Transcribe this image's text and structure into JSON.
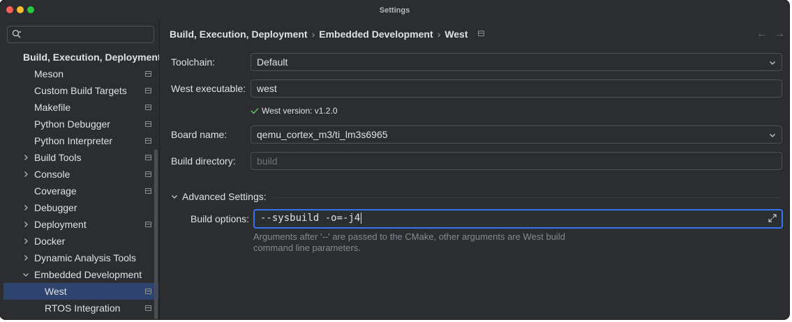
{
  "window": {
    "title": "Settings"
  },
  "search": {
    "placeholder": ""
  },
  "sidebar": {
    "items": [
      {
        "label": "Build, Execution, Deployment",
        "level": 0,
        "chevron": "none",
        "header": true,
        "page_icon": false,
        "selected": false
      },
      {
        "label": "Meson",
        "level": 1,
        "chevron": "none",
        "page_icon": true,
        "selected": false
      },
      {
        "label": "Custom Build Targets",
        "level": 1,
        "chevron": "none",
        "page_icon": true,
        "selected": false
      },
      {
        "label": "Makefile",
        "level": 1,
        "chevron": "none",
        "page_icon": true,
        "selected": false
      },
      {
        "label": "Python Debugger",
        "level": 1,
        "chevron": "none",
        "page_icon": true,
        "selected": false
      },
      {
        "label": "Python Interpreter",
        "level": 1,
        "chevron": "none",
        "page_icon": true,
        "selected": false
      },
      {
        "label": "Build Tools",
        "level": 1,
        "chevron": "right",
        "page_icon": true,
        "selected": false
      },
      {
        "label": "Console",
        "level": 1,
        "chevron": "right",
        "page_icon": true,
        "selected": false
      },
      {
        "label": "Coverage",
        "level": 1,
        "chevron": "none",
        "page_icon": true,
        "selected": false
      },
      {
        "label": "Debugger",
        "level": 1,
        "chevron": "right",
        "page_icon": false,
        "selected": false
      },
      {
        "label": "Deployment",
        "level": 1,
        "chevron": "right",
        "page_icon": true,
        "selected": false
      },
      {
        "label": "Docker",
        "level": 1,
        "chevron": "right",
        "page_icon": false,
        "selected": false
      },
      {
        "label": "Dynamic Analysis Tools",
        "level": 1,
        "chevron": "right",
        "page_icon": false,
        "selected": false
      },
      {
        "label": "Embedded Development",
        "level": 1,
        "chevron": "down",
        "page_icon": false,
        "selected": false
      },
      {
        "label": "West",
        "level": 2,
        "chevron": "none",
        "page_icon": true,
        "selected": true
      },
      {
        "label": "RTOS Integration",
        "level": 2,
        "chevron": "none",
        "page_icon": true,
        "selected": false
      }
    ]
  },
  "breadcrumb": {
    "parts": [
      "Build, Execution, Deployment",
      "Embedded Development",
      "West"
    ],
    "separator": "›"
  },
  "nav": {
    "back": "←",
    "forward": "→"
  },
  "form": {
    "toolchain": {
      "label": "Toolchain:",
      "value": "Default"
    },
    "west_executable": {
      "label": "West executable:",
      "value": "west"
    },
    "west_version": "West version: v1.2.0",
    "board_name": {
      "label": "Board name:",
      "value": "qemu_cortex_m3/ti_lm3s6965"
    },
    "build_directory": {
      "label": "Build directory:",
      "placeholder": "build"
    },
    "advanced": {
      "label": "Advanced Settings:"
    },
    "build_options": {
      "label": "Build options:",
      "value": "--sysbuild -o=-j4"
    },
    "hint_line1": "Arguments after '--' are passed to the CMake, other arguments are West build",
    "hint_line2": "command line parameters."
  },
  "colors": {
    "accent": "#3574f0",
    "selection": "#2e436e",
    "background": "#2b2d30",
    "success": "#5fb865"
  },
  "icons": {
    "search": "search-icon",
    "check": "check-icon",
    "expand": "expand-icon",
    "page": "page-icon"
  }
}
